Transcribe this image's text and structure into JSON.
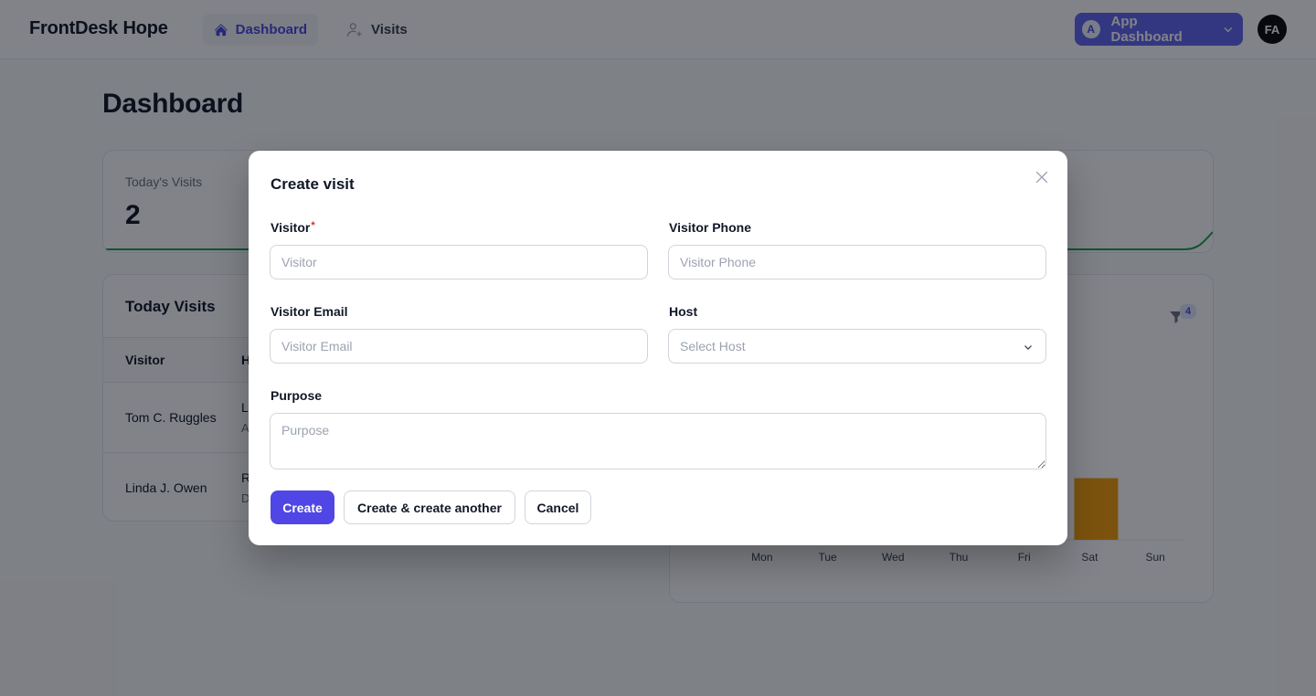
{
  "app": {
    "brand": "FrontDesk Hope"
  },
  "nav": {
    "dashboard_label": "Dashboard",
    "visits_label": "Visits"
  },
  "tenant": {
    "badge": "A",
    "label": "App Dashboard"
  },
  "user": {
    "initials": "FA"
  },
  "page": {
    "title": "Dashboard"
  },
  "stats": {
    "todays_visits_label": "Today's Visits",
    "todays_visits_value": "2"
  },
  "today_visits": {
    "title": "Today Visits",
    "columns": [
      "Visitor",
      "H"
    ],
    "rows": [
      {
        "visitor": "Tom C. Ruggles",
        "host": "L",
        "sub": "A"
      },
      {
        "visitor": "Linda J. Owen",
        "host": "R",
        "sub": "D"
      }
    ]
  },
  "chart": {
    "filter_count": "4"
  },
  "chart_data": {
    "type": "bar",
    "categories": [
      "Mon",
      "Tue",
      "Wed",
      "Thu",
      "Fri",
      "Sat",
      "Sun"
    ],
    "values": [
      0,
      0,
      0,
      0,
      0,
      1,
      0
    ],
    "bar_color": "#f59e0b"
  },
  "modal": {
    "title": "Create visit",
    "visitor_label": "Visitor",
    "visitor_required": "*",
    "visitor_placeholder": "Visitor",
    "visitor_phone_label": "Visitor Phone",
    "visitor_phone_placeholder": "Visitor Phone",
    "visitor_email_label": "Visitor Email",
    "visitor_email_placeholder": "Visitor Email",
    "host_label": "Host",
    "host_placeholder": "Select Host",
    "purpose_label": "Purpose",
    "purpose_placeholder": "Purpose",
    "create_label": "Create",
    "create_another_label": "Create & create another",
    "cancel_label": "Cancel"
  },
  "colors": {
    "accent": "#4f46e5",
    "tenant_bg": "#6366f1",
    "stat_line": "#16a34a"
  }
}
